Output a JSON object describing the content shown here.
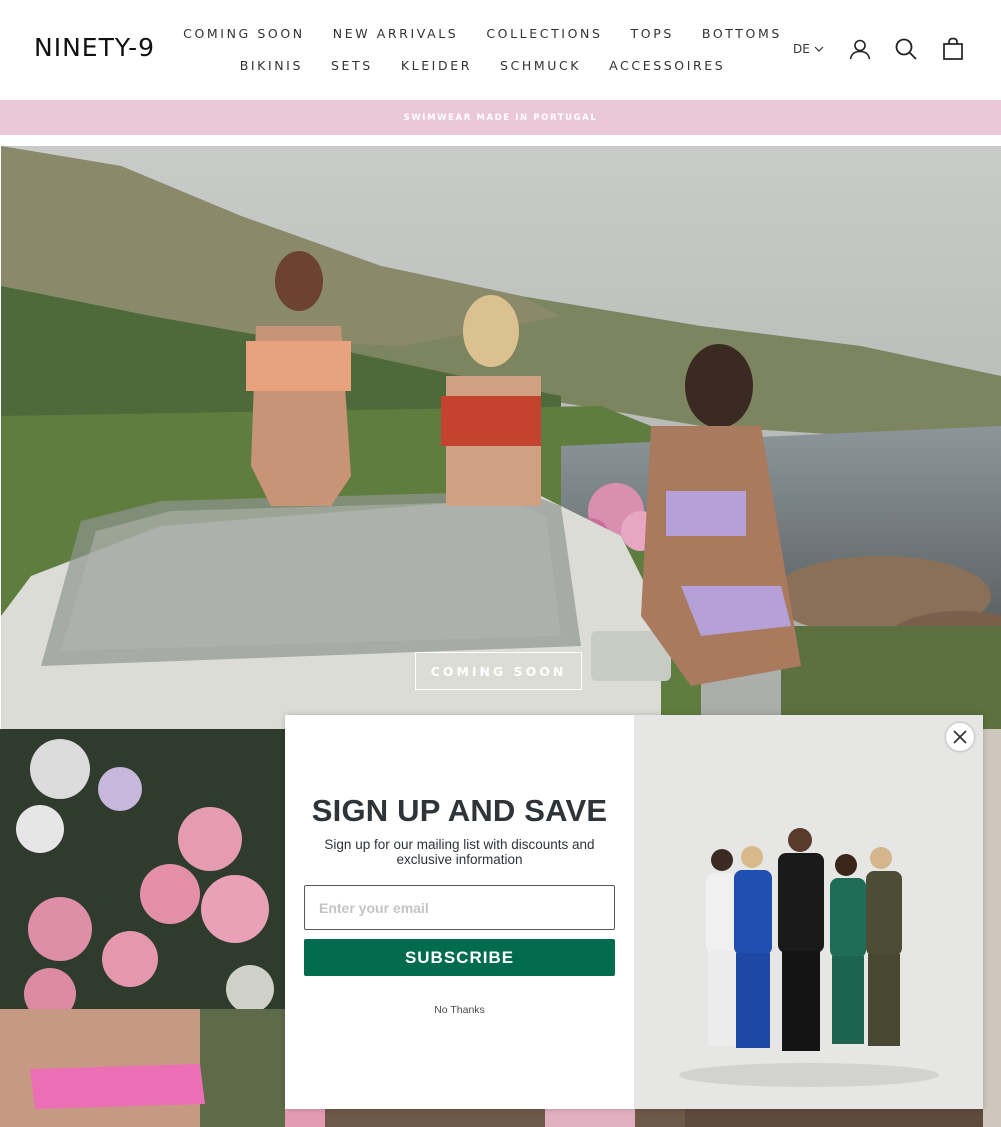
{
  "header": {
    "logo": "NINETY-9",
    "nav_row1": [
      "COMING SOON",
      "NEW ARRIVALS",
      "COLLECTIONS",
      "TOPS",
      "BOTTOMS"
    ],
    "nav_row2": [
      "BIKINIS",
      "SETS",
      "KLEIDER",
      "SCHMUCK",
      "ACCESSOIRES"
    ],
    "language": "DE",
    "icons": {
      "account": "account-icon",
      "search": "search-icon",
      "cart": "cart-icon"
    }
  },
  "announcement": {
    "text": "SWIMWEAR MADE IN PORTUGAL",
    "background": "#ebc8d8"
  },
  "hero": {
    "button_label": "COMING SOON"
  },
  "popup": {
    "title": "SIGN UP AND SAVE",
    "description": "Sign up for our mailing list with discounts and exclusive information",
    "email_placeholder": "Enter your email",
    "email_value": "",
    "subscribe_label": "SUBSCRIBE",
    "no_thanks_label": "No Thanks",
    "subscribe_color": "#006b4e",
    "close_icon": "close-icon"
  }
}
